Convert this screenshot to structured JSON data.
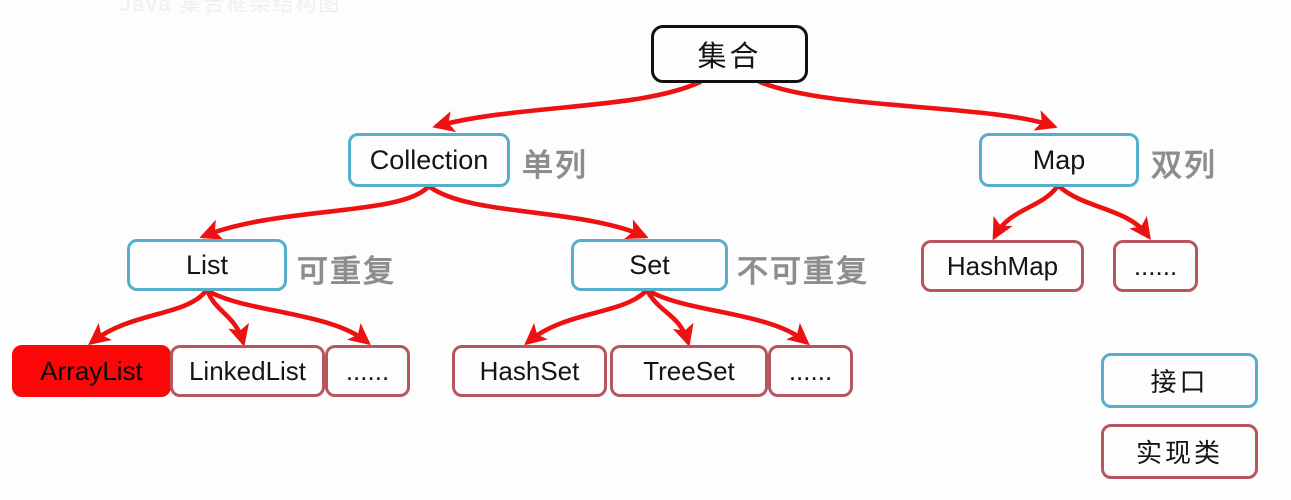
{
  "diagram": {
    "title_hint": "Java 集合框架结构图",
    "colors": {
      "root_border": "#111111",
      "interface_border": "#56aecd",
      "impl_border": "#b5575e",
      "arrow": "#ee1111",
      "highlight_fill": "#fb0707",
      "tag_text": "#8d8d8d",
      "background": "#fdfdfd"
    },
    "nodes": {
      "root": {
        "label": "集合"
      },
      "collection": {
        "label": "Collection"
      },
      "map": {
        "label": "Map"
      },
      "list": {
        "label": "List"
      },
      "set": {
        "label": "Set"
      },
      "hashmap": {
        "label": "HashMap"
      },
      "map_more": {
        "label": "......"
      },
      "arraylist": {
        "label": "ArrayList"
      },
      "linkedlist": {
        "label": "LinkedList"
      },
      "list_more": {
        "label": "......"
      },
      "hashset": {
        "label": "HashSet"
      },
      "treeset": {
        "label": "TreeSet"
      },
      "set_more": {
        "label": "......"
      }
    },
    "tags": {
      "single_column": "单列",
      "double_column": "双列",
      "repeatable": "可重复",
      "not_repeatable": "不可重复"
    },
    "legend": {
      "interface": "接口",
      "implementation": "实现类"
    }
  }
}
